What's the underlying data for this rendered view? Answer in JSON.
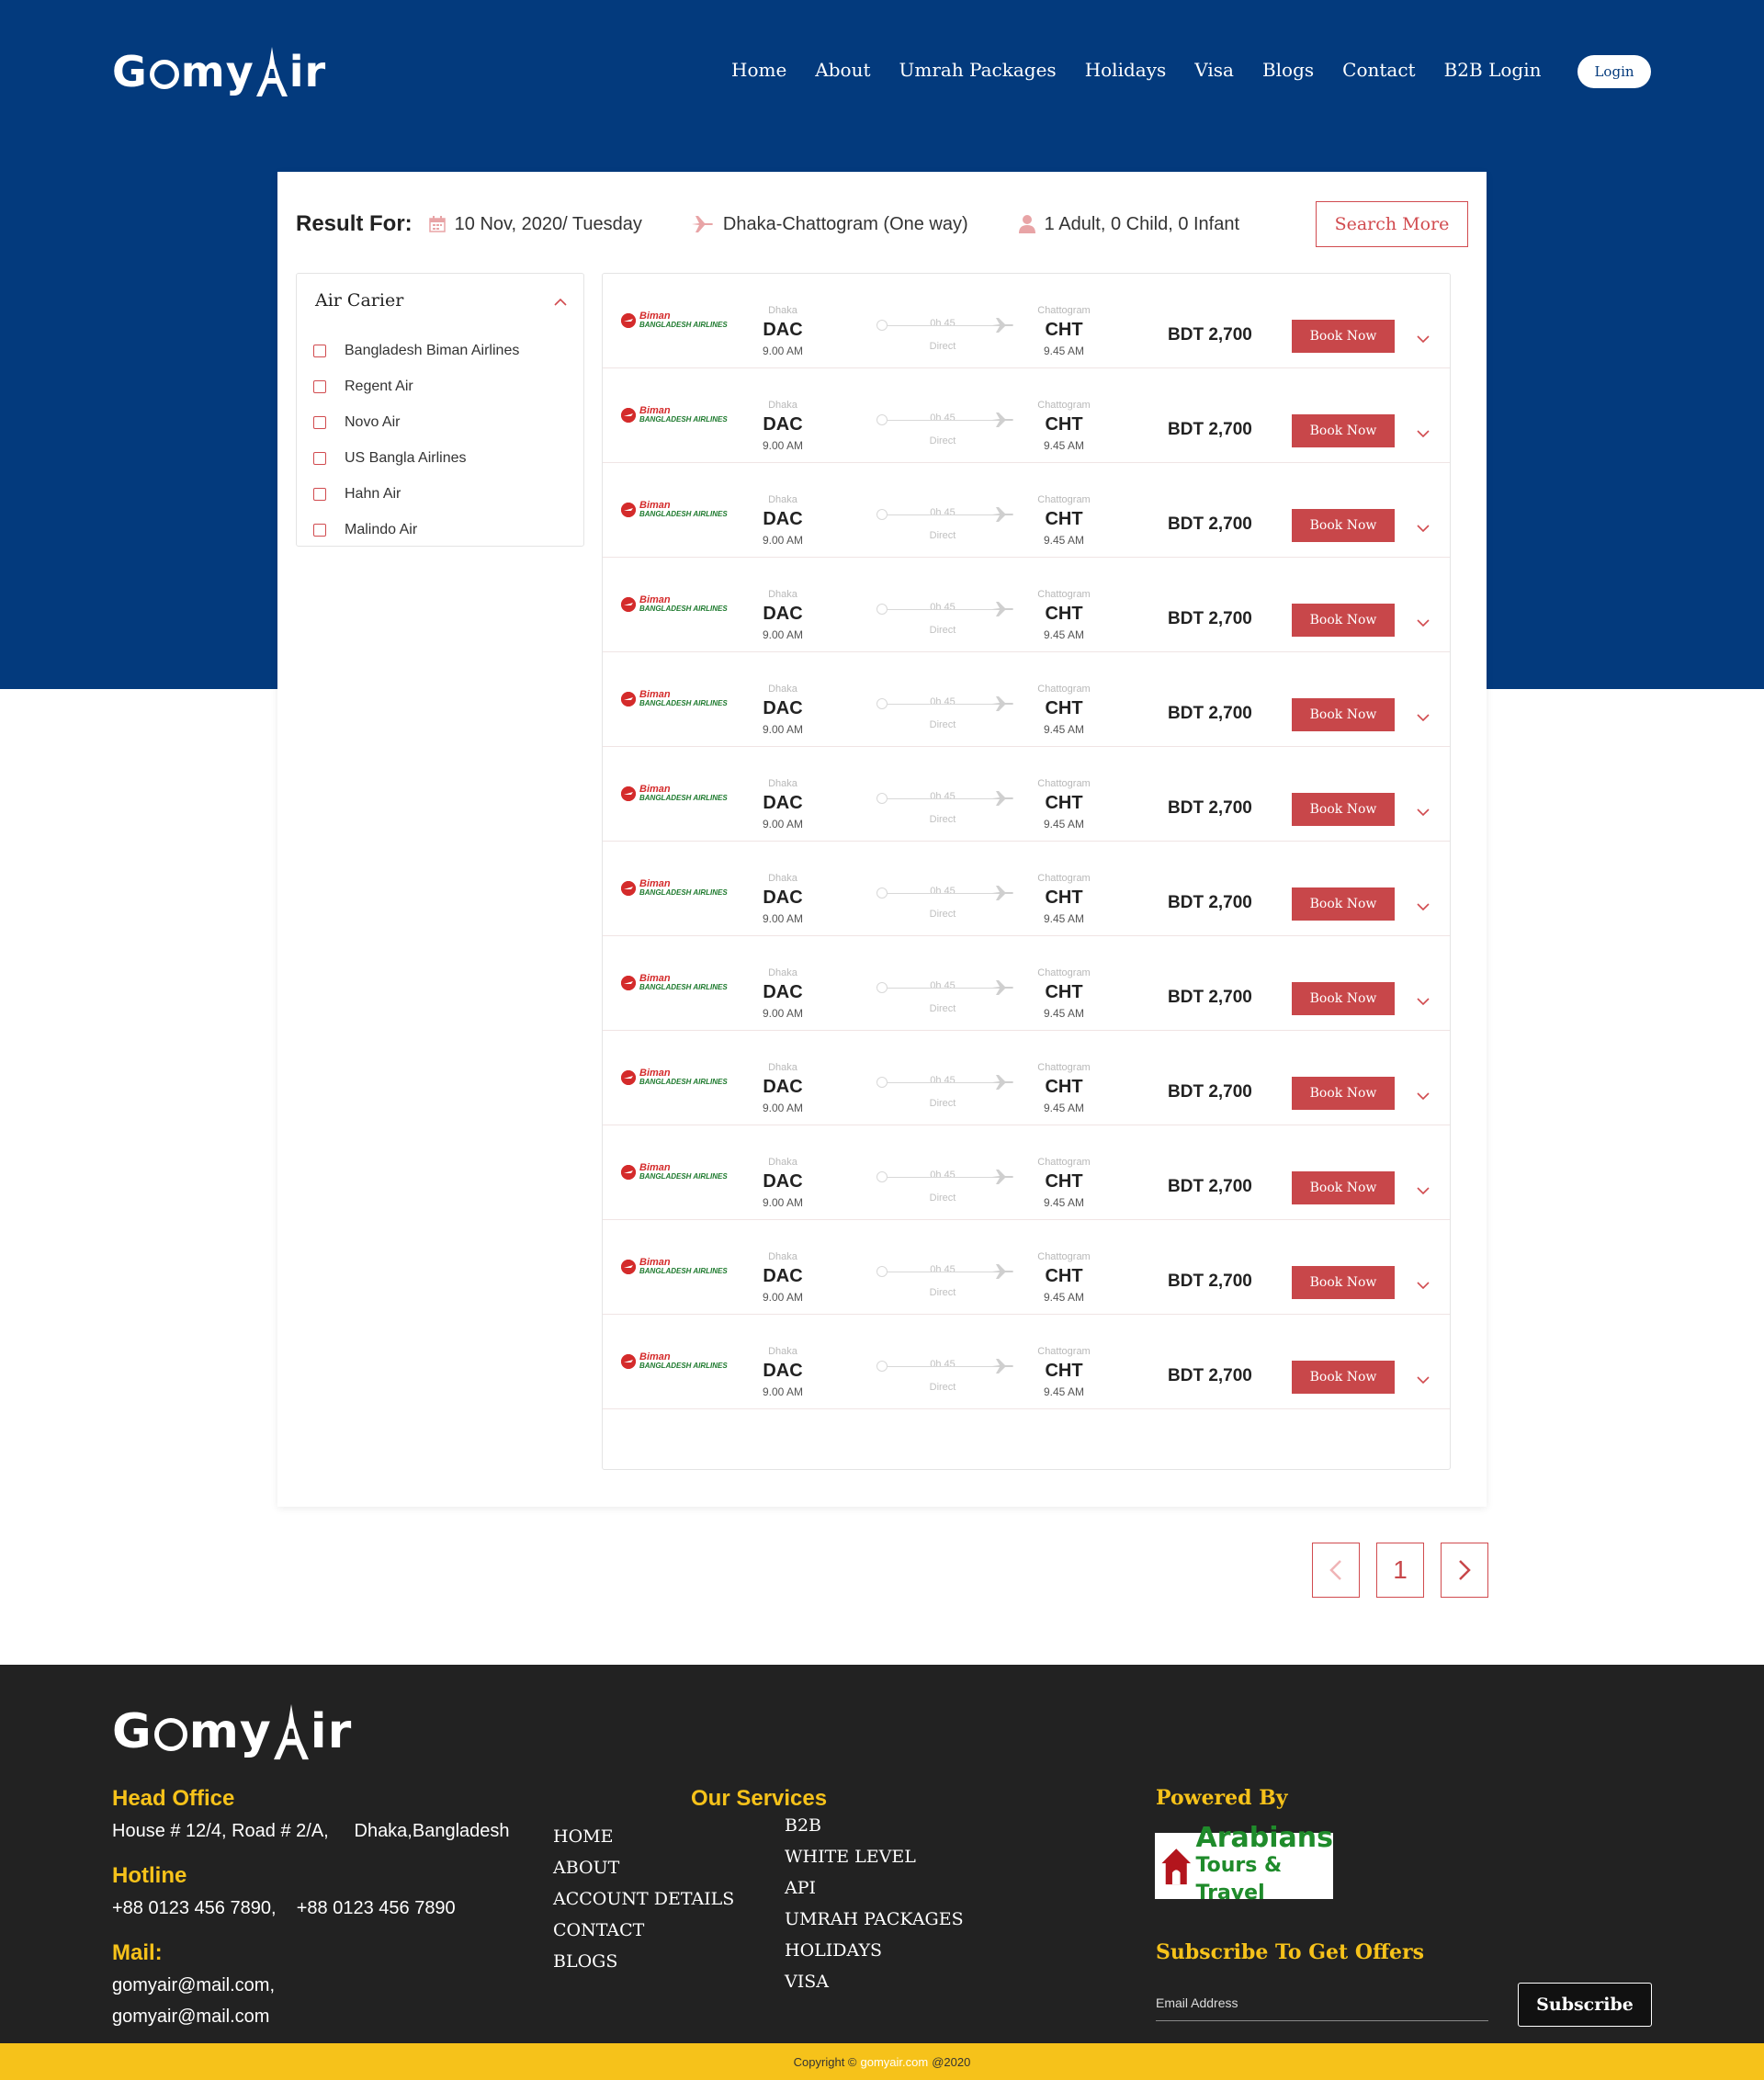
{
  "brand": {
    "logo_pre": "G",
    "logo_mid": "my",
    "logo_post": "ir"
  },
  "nav": {
    "items": [
      "Home",
      "About",
      "Umrah Packages",
      "Holidays",
      "Visa",
      "Blogs",
      "Contact",
      "B2B Login"
    ],
    "login": "Login"
  },
  "result": {
    "title": "Result For:",
    "date": "10 Nov, 2020/ Tuesday",
    "route": "Dhaka-Chattogram (One way)",
    "passengers": "1 Adult, 0 Child, 0 Infant",
    "search_more": "Search More"
  },
  "filter": {
    "title": "Air Carier",
    "airlines": [
      "Bangladesh Biman Airlines",
      "Regent Air",
      "Novo Air",
      "US Bangla Airlines",
      "Hahn Air",
      "Malindo Air"
    ]
  },
  "flights": [
    {
      "airline_1": "Biman",
      "airline_2": "BANGLADESH AIRLINES",
      "from_city": "Dhaka",
      "from_code": "DAC",
      "dep_time": "9.00 AM",
      "duration": "0h 45",
      "stops": "Direct",
      "to_city": "Chattogram",
      "to_code": "CHT",
      "arr_time": "9.45 AM",
      "price": "BDT 2,700",
      "book": "Book Now"
    },
    {
      "airline_1": "Biman",
      "airline_2": "BANGLADESH AIRLINES",
      "from_city": "Dhaka",
      "from_code": "DAC",
      "dep_time": "9.00 AM",
      "duration": "0h 45",
      "stops": "Direct",
      "to_city": "Chattogram",
      "to_code": "CHT",
      "arr_time": "9.45 AM",
      "price": "BDT 2,700",
      "book": "Book Now"
    },
    {
      "airline_1": "Biman",
      "airline_2": "BANGLADESH AIRLINES",
      "from_city": "Dhaka",
      "from_code": "DAC",
      "dep_time": "9.00 AM",
      "duration": "0h 45",
      "stops": "Direct",
      "to_city": "Chattogram",
      "to_code": "CHT",
      "arr_time": "9.45 AM",
      "price": "BDT 2,700",
      "book": "Book Now"
    },
    {
      "airline_1": "Biman",
      "airline_2": "BANGLADESH AIRLINES",
      "from_city": "Dhaka",
      "from_code": "DAC",
      "dep_time": "9.00 AM",
      "duration": "0h 45",
      "stops": "Direct",
      "to_city": "Chattogram",
      "to_code": "CHT",
      "arr_time": "9.45 AM",
      "price": "BDT 2,700",
      "book": "Book Now"
    },
    {
      "airline_1": "Biman",
      "airline_2": "BANGLADESH AIRLINES",
      "from_city": "Dhaka",
      "from_code": "DAC",
      "dep_time": "9.00 AM",
      "duration": "0h 45",
      "stops": "Direct",
      "to_city": "Chattogram",
      "to_code": "CHT",
      "arr_time": "9.45 AM",
      "price": "BDT 2,700",
      "book": "Book Now"
    },
    {
      "airline_1": "Biman",
      "airline_2": "BANGLADESH AIRLINES",
      "from_city": "Dhaka",
      "from_code": "DAC",
      "dep_time": "9.00 AM",
      "duration": "0h 45",
      "stops": "Direct",
      "to_city": "Chattogram",
      "to_code": "CHT",
      "arr_time": "9.45 AM",
      "price": "BDT 2,700",
      "book": "Book Now"
    },
    {
      "airline_1": "Biman",
      "airline_2": "BANGLADESH AIRLINES",
      "from_city": "Dhaka",
      "from_code": "DAC",
      "dep_time": "9.00 AM",
      "duration": "0h 45",
      "stops": "Direct",
      "to_city": "Chattogram",
      "to_code": "CHT",
      "arr_time": "9.45 AM",
      "price": "BDT 2,700",
      "book": "Book Now"
    },
    {
      "airline_1": "Biman",
      "airline_2": "BANGLADESH AIRLINES",
      "from_city": "Dhaka",
      "from_code": "DAC",
      "dep_time": "9.00 AM",
      "duration": "0h 45",
      "stops": "Direct",
      "to_city": "Chattogram",
      "to_code": "CHT",
      "arr_time": "9.45 AM",
      "price": "BDT 2,700",
      "book": "Book Now"
    },
    {
      "airline_1": "Biman",
      "airline_2": "BANGLADESH AIRLINES",
      "from_city": "Dhaka",
      "from_code": "DAC",
      "dep_time": "9.00 AM",
      "duration": "0h 45",
      "stops": "Direct",
      "to_city": "Chattogram",
      "to_code": "CHT",
      "arr_time": "9.45 AM",
      "price": "BDT 2,700",
      "book": "Book Now"
    },
    {
      "airline_1": "Biman",
      "airline_2": "BANGLADESH AIRLINES",
      "from_city": "Dhaka",
      "from_code": "DAC",
      "dep_time": "9.00 AM",
      "duration": "0h 45",
      "stops": "Direct",
      "to_city": "Chattogram",
      "to_code": "CHT",
      "arr_time": "9.45 AM",
      "price": "BDT 2,700",
      "book": "Book Now"
    },
    {
      "airline_1": "Biman",
      "airline_2": "BANGLADESH AIRLINES",
      "from_city": "Dhaka",
      "from_code": "DAC",
      "dep_time": "9.00 AM",
      "duration": "0h 45",
      "stops": "Direct",
      "to_city": "Chattogram",
      "to_code": "CHT",
      "arr_time": "9.45 AM",
      "price": "BDT 2,700",
      "book": "Book Now"
    },
    {
      "airline_1": "Biman",
      "airline_2": "BANGLADESH AIRLINES",
      "from_city": "Dhaka",
      "from_code": "DAC",
      "dep_time": "9.00 AM",
      "duration": "0h 45",
      "stops": "Direct",
      "to_city": "Chattogram",
      "to_code": "CHT",
      "arr_time": "9.45 AM",
      "price": "BDT 2,700",
      "book": "Book Now"
    }
  ],
  "pagination": {
    "current": "1",
    "prev_icon": "chevron-left-icon",
    "next_icon": "chevron-right-icon"
  },
  "footer": {
    "head_office_title": "Head Office",
    "head_office": "House # 12/4, Road # 2/A,     Dhaka,Bangladesh",
    "hotline_title": "Hotline",
    "hotline": "+88 0123 456 7890,    +88 0123 456 7890",
    "mail_title": "Mail:",
    "mail_1": "gomyair@mail.com,",
    "mail_2": "gomyair@mail.com",
    "services_title": "Our Services",
    "services_col1": [
      "HOME",
      "ABOUT",
      "ACCOUNT DETAILS",
      "CONTACT",
      "BLOGS"
    ],
    "services_col2": [
      "B2B",
      "WHITE LEVEL",
      "API",
      "UMRAH PACKAGES",
      "HOLIDAYS",
      "VISA"
    ],
    "powered_title": "Powered By",
    "powered_1": "Arabians",
    "powered_2": "Tours & Travel",
    "subscribe_title": "Subscribe To Get Offers",
    "email_placeholder": "Email Address",
    "subscribe_btn": "Subscribe",
    "copyright_pre": "Copyright ©",
    "copyright_site": "gomyair.com",
    "copyright_post": "@2020"
  },
  "colors": {
    "hero": "#033a7d",
    "accent": "#c8474a",
    "footer": "#222222",
    "gold": "#f6c21a"
  }
}
